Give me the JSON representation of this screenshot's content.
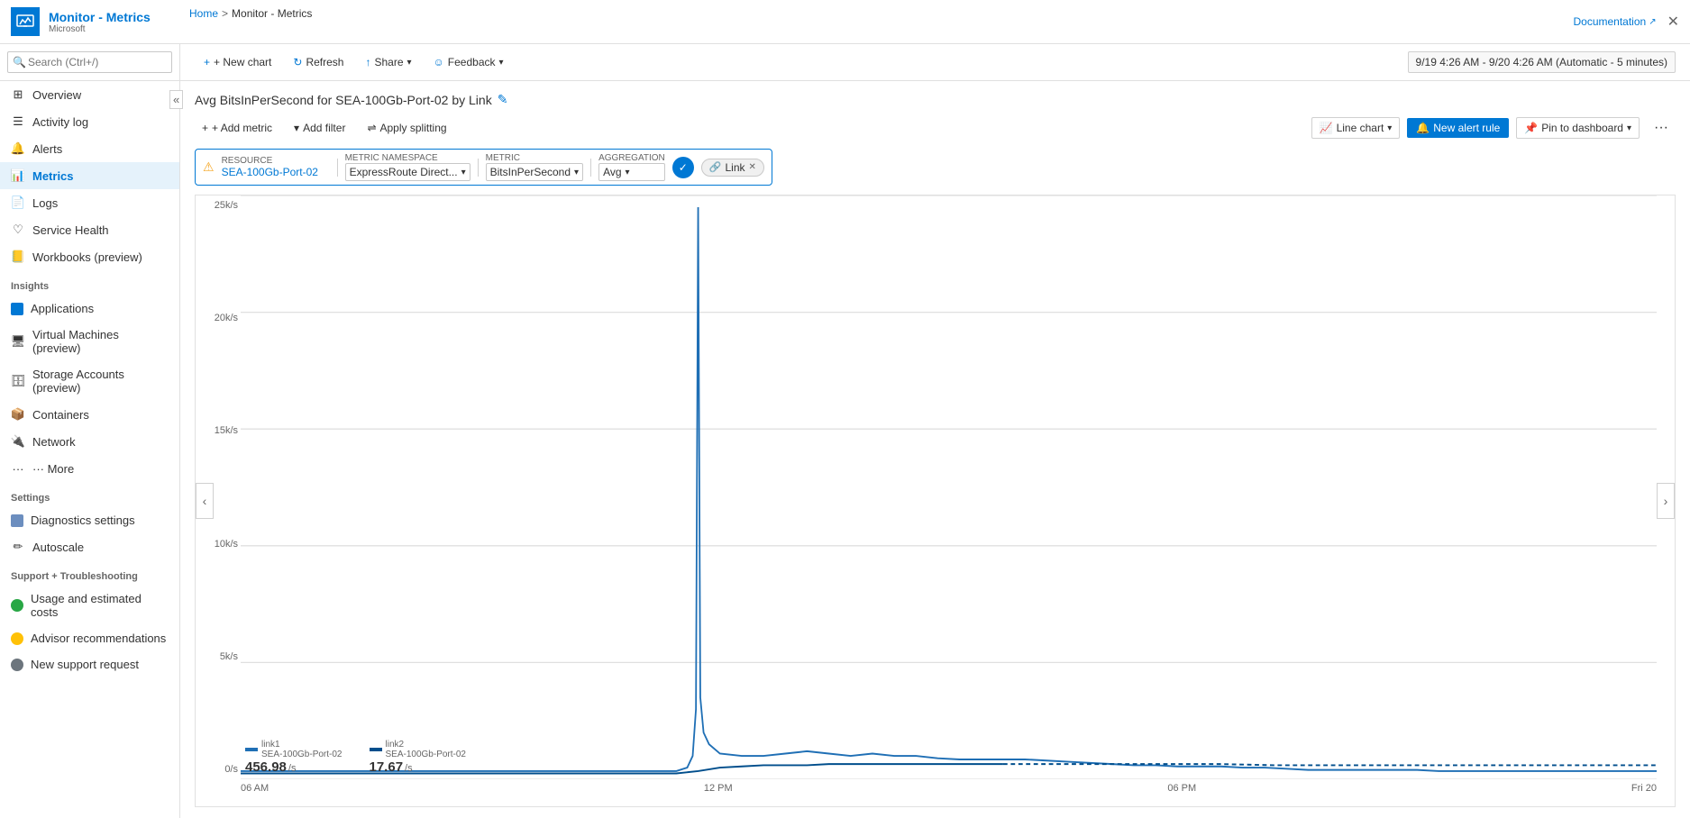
{
  "app": {
    "title": "Monitor - Metrics",
    "subtitle": "Microsoft",
    "documentation_link": "Documentation",
    "close_label": "✕"
  },
  "breadcrumb": {
    "home": "Home",
    "separator": ">",
    "current": "Monitor - Metrics"
  },
  "search": {
    "placeholder": "Search (Ctrl+/)"
  },
  "sidebar": {
    "collapse_icon": "«",
    "items": [
      {
        "id": "overview",
        "label": "Overview",
        "icon": "grid"
      },
      {
        "id": "activity-log",
        "label": "Activity log",
        "icon": "list"
      },
      {
        "id": "alerts",
        "label": "Alerts",
        "icon": "bell"
      },
      {
        "id": "metrics",
        "label": "Metrics",
        "icon": "chart",
        "active": true
      },
      {
        "id": "logs",
        "label": "Logs",
        "icon": "doc"
      },
      {
        "id": "service-health",
        "label": "Service Health",
        "icon": "heart"
      },
      {
        "id": "workbooks",
        "label": "Workbooks (preview)",
        "icon": "book"
      }
    ],
    "insights_label": "Insights",
    "insights_items": [
      {
        "id": "applications",
        "label": "Applications",
        "icon": "app"
      },
      {
        "id": "virtual-machines",
        "label": "Virtual Machines (preview)",
        "icon": "vm"
      },
      {
        "id": "storage-accounts",
        "label": "Storage Accounts (preview)",
        "icon": "storage"
      },
      {
        "id": "containers",
        "label": "Containers",
        "icon": "container"
      },
      {
        "id": "network",
        "label": "Network",
        "icon": "network"
      },
      {
        "id": "more",
        "label": "··· More",
        "icon": ""
      }
    ],
    "settings_label": "Settings",
    "settings_items": [
      {
        "id": "diagnostics",
        "label": "Diagnostics settings",
        "icon": "diag"
      },
      {
        "id": "autoscale",
        "label": "Autoscale",
        "icon": "scale"
      }
    ],
    "support_label": "Support + Troubleshooting",
    "support_items": [
      {
        "id": "usage",
        "label": "Usage and estimated costs",
        "icon": "circle-green"
      },
      {
        "id": "advisor",
        "label": "Advisor recommendations",
        "icon": "advisor"
      },
      {
        "id": "support",
        "label": "New support request",
        "icon": "support"
      }
    ]
  },
  "toolbar": {
    "new_chart": "+ New chart",
    "refresh": "Refresh",
    "share": "Share",
    "feedback": "Feedback",
    "time_range": "9/19 4:26 AM - 9/20 4:26 AM (Automatic - 5 minutes)"
  },
  "chart": {
    "title": "Avg BitsInPerSecond for SEA-100Gb-Port-02 by Link",
    "edit_icon": "✎",
    "add_metric": "+ Add metric",
    "add_filter": "Add filter",
    "apply_splitting": "Apply splitting",
    "chart_type": "Line chart",
    "new_alert_rule": "New alert rule",
    "pin_to_dashboard": "Pin to dashboard",
    "more": "···",
    "resource_label": "RESOURCE",
    "resource_value": "SEA-100Gb-Port-02",
    "namespace_label": "METRIC NAMESPACE",
    "namespace_value": "ExpressRoute Direct...",
    "metric_label": "METRIC",
    "metric_value": "BitsInPerSecond",
    "aggregation_label": "AGGREGATION",
    "aggregation_value": "Avg",
    "link_tag": "Link",
    "y_axis": [
      "25k/s",
      "20k/s",
      "15k/s",
      "10k/s",
      "5k/s",
      "0/s"
    ],
    "x_axis": [
      "06 AM",
      "12 PM",
      "06 PM",
      "Fri 20"
    ],
    "legend": [
      {
        "id": "link1",
        "name": "link1\nSEA-100Gb-Port-02",
        "color": "#1f6fb5",
        "value": "456.98",
        "unit": "/s"
      },
      {
        "id": "link2",
        "name": "link2\nSEA-100Gb-Port-02",
        "color": "#004e8c",
        "value": "17.67",
        "unit": "/s"
      }
    ]
  }
}
